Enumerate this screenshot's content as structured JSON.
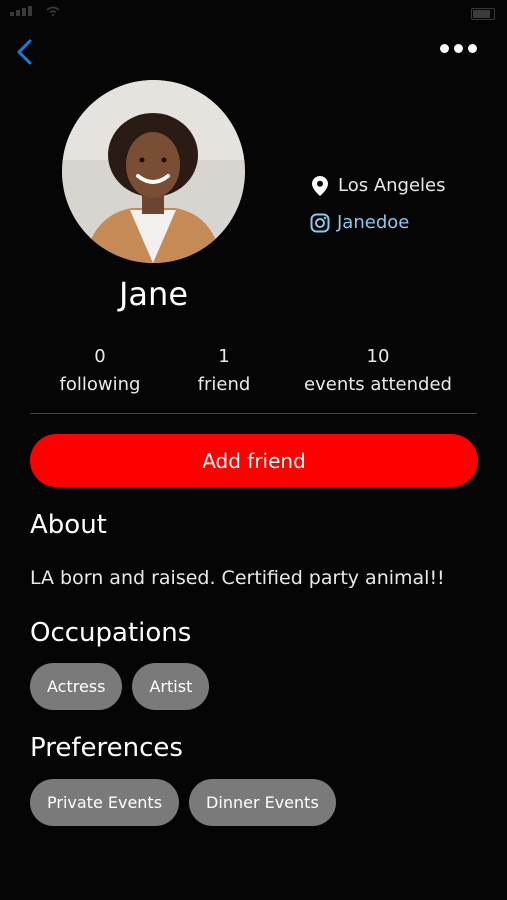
{
  "profile": {
    "name": "Jane",
    "location": "Los Angeles",
    "instagram": "Janedoe"
  },
  "stats": {
    "following_count": "0",
    "following_label": "following",
    "friends_count": "1",
    "friends_label": "friend",
    "events_count": "10",
    "events_label": "events attended"
  },
  "actions": {
    "add_friend_label": "Add friend"
  },
  "about": {
    "title": "About",
    "text": "LA born and raised. Certified party animal!!"
  },
  "occupations": {
    "title": "Occupations",
    "items": [
      "Actress",
      "Artist"
    ]
  },
  "preferences": {
    "title": "Preferences",
    "items": [
      "Private Events",
      "Dinner Events"
    ]
  },
  "colors": {
    "background": "#050505",
    "accent": "#ff0000",
    "link": "#8cc7f0",
    "nav_blue": "#1f7ae0",
    "chip": "#7a7a7a"
  },
  "icons": [
    "back-chevron-icon",
    "more-dots-icon",
    "location-pin-icon",
    "instagram-icon"
  ]
}
